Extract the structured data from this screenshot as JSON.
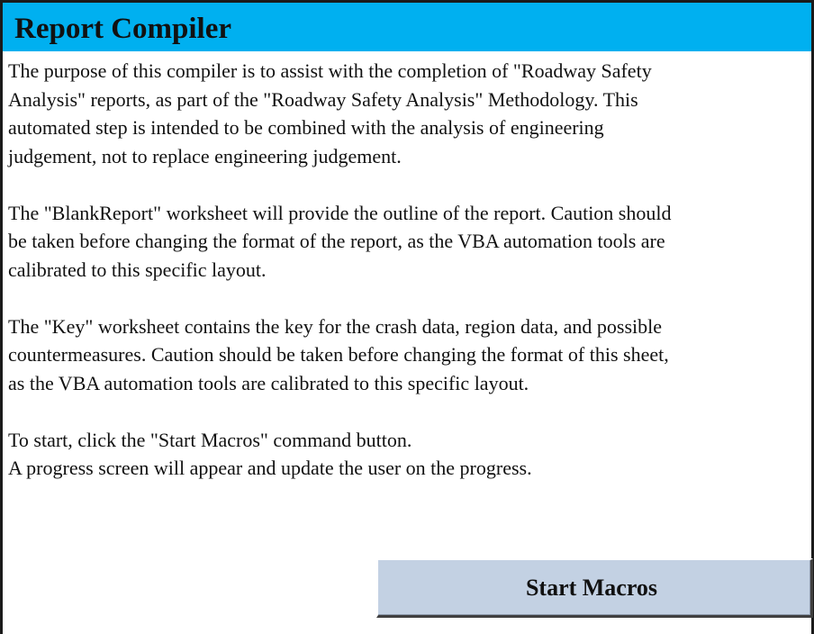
{
  "header": {
    "title": "Report Compiler"
  },
  "description": {
    "paragraph_1": [
      "The purpose of this compiler is to assist with the completion of \"Roadway Safety",
      "Analysis\" reports, as part of the \"Roadway Safety Analysis\" Methodology. This",
      "automated step is intended to be combined with the analysis of engineering",
      "judgement, not to replace engineering judgement."
    ],
    "paragraph_2": [
      "The \"BlankReport\" worksheet will provide the outline of the report. Caution should",
      "be taken before changing the format of the report, as the VBA automation tools are",
      "calibrated to this specific layout."
    ],
    "paragraph_3": [
      "The \"Key\" worksheet contains the key for the crash data, region data, and possible",
      "countermeasures. Caution should be taken before changing the format of this sheet,",
      "as the VBA automation tools are calibrated to this specific layout."
    ],
    "paragraph_4": [
      "To start, click the \"Start Macros\" command button.",
      "A progress screen will appear and update the user on the progress."
    ]
  },
  "actions": {
    "start_macros_label": "Start Macros"
  },
  "colors": {
    "title_bar": "#00b0f0",
    "button_face": "#c3d1e3",
    "frame": "#1a1a1a"
  }
}
